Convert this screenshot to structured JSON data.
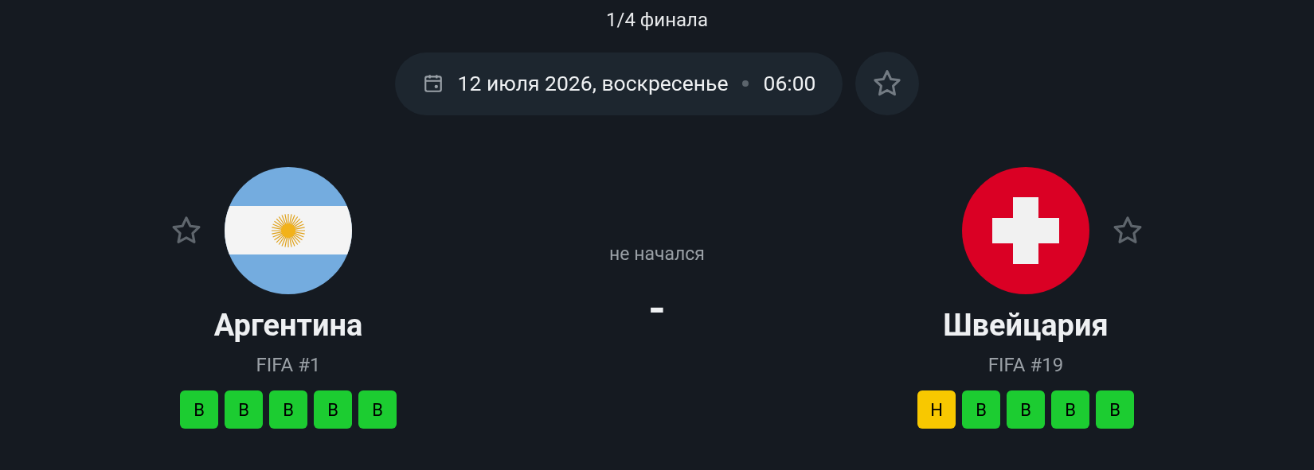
{
  "stage": "1/4 финала",
  "schedule": {
    "date": "12 июля 2026, воскресенье",
    "time": "06:00"
  },
  "teams": [
    {
      "name": "Аргентина",
      "kind": "argentina",
      "ranking": "FIFA #1",
      "form": [
        {
          "label": "В",
          "kind": "win"
        },
        {
          "label": "В",
          "kind": "win"
        },
        {
          "label": "В",
          "kind": "win"
        },
        {
          "label": "В",
          "kind": "win"
        },
        {
          "label": "В",
          "kind": "win"
        }
      ]
    },
    {
      "name": "Швейцария",
      "kind": "switzerland",
      "ranking": "FIFA #19",
      "form": [
        {
          "label": "Н",
          "kind": "draw"
        },
        {
          "label": "В",
          "kind": "win"
        },
        {
          "label": "В",
          "kind": "win"
        },
        {
          "label": "В",
          "kind": "win"
        },
        {
          "label": "В",
          "kind": "win"
        }
      ]
    }
  ],
  "match": {
    "status": "не начался",
    "score": "-"
  }
}
